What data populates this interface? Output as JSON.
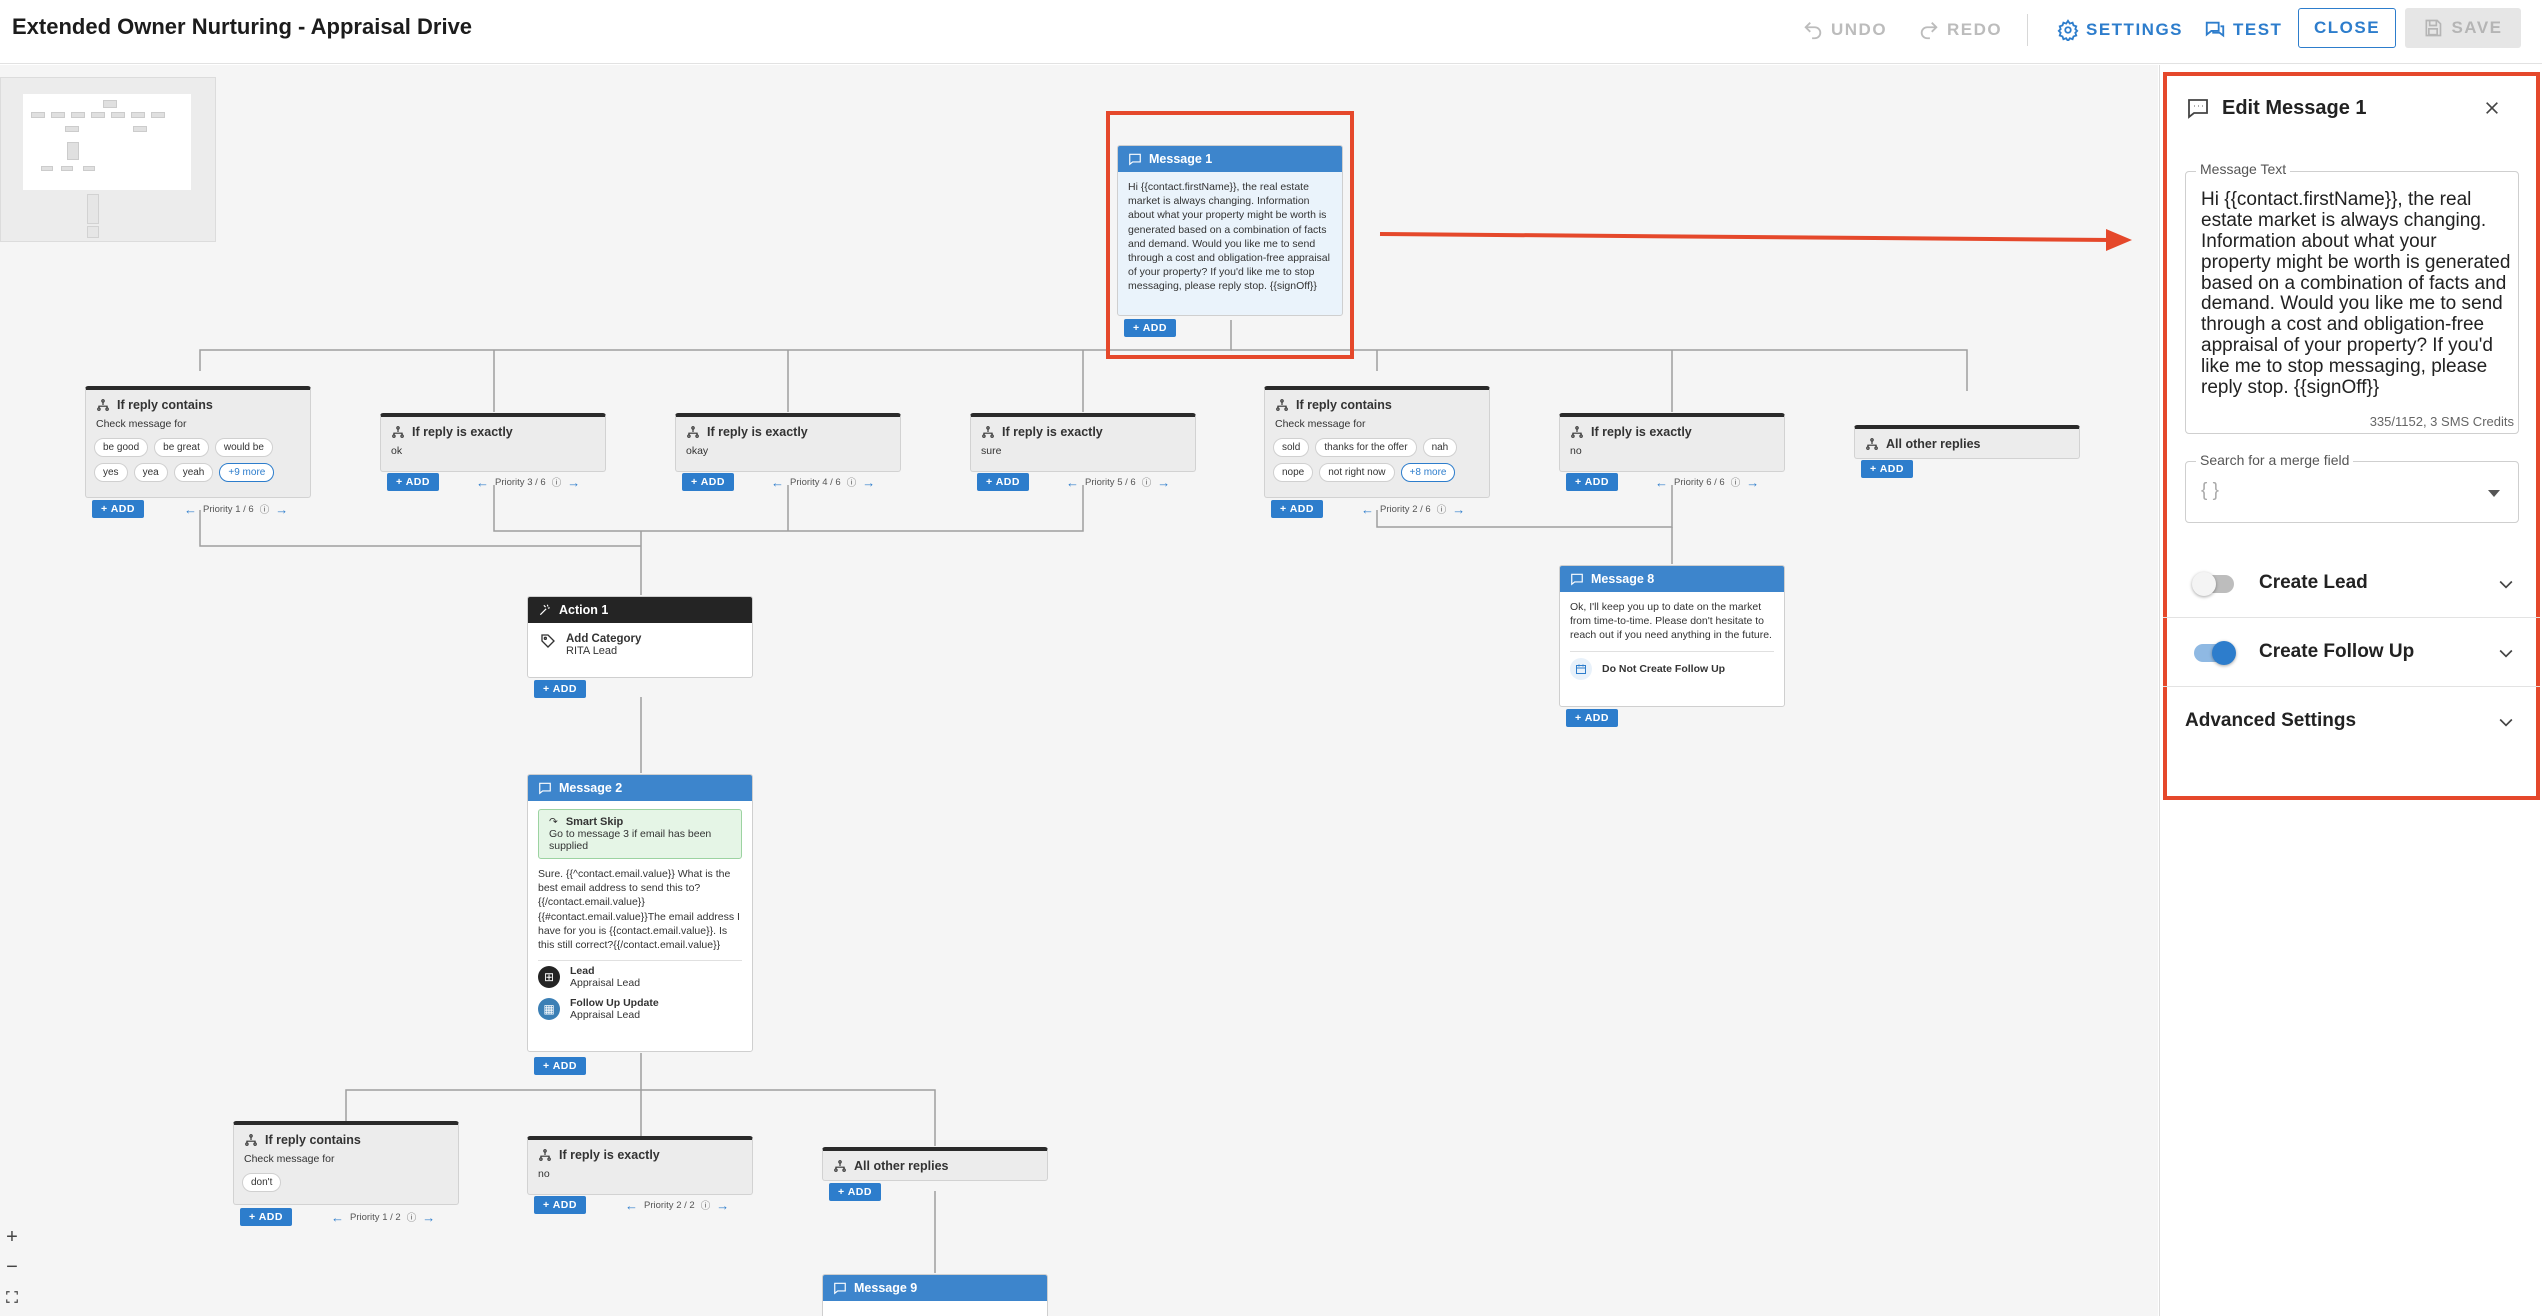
{
  "app": {
    "title": "Extended Owner Nurturing - Appraisal Drive"
  },
  "toolbar": {
    "undo": "UNDO",
    "redo": "REDO",
    "settings": "SETTINGS",
    "test": "TEST",
    "close": "CLOSE",
    "save": "SAVE"
  },
  "nodes": {
    "message1": {
      "title": "Message 1",
      "text": "Hi {{contact.firstName}}, the real estate market is always changing. Information about what your property might be worth is generated based on a combination of facts and demand. Would you like me to send through a cost and obligation-free appraisal of your property? If you'd like me to stop messaging, please reply stop. {{signOff}}"
    },
    "cond1": {
      "title": "If reply contains",
      "sub": "Check message for",
      "chips": [
        "be good",
        "be great",
        "would be",
        "yes",
        "yea",
        "yeah"
      ],
      "more": "+9 more",
      "priority": "Priority 1 / 6"
    },
    "cond2": {
      "title": "If reply is exactly",
      "value": "ok",
      "priority": "Priority 3 / 6"
    },
    "cond3": {
      "title": "If reply is exactly",
      "value": "okay",
      "priority": "Priority 4 / 6"
    },
    "cond4": {
      "title": "If reply is exactly",
      "value": "sure",
      "priority": "Priority 5 / 6"
    },
    "cond5": {
      "title": "If reply contains",
      "sub": "Check message for",
      "chips": [
        "sold",
        "thanks for the offer",
        "nah",
        "nope",
        "not right now"
      ],
      "more": "+8 more",
      "priority": "Priority 2 / 6"
    },
    "cond6": {
      "title": "If reply is exactly",
      "value": "no",
      "priority": "Priority 6 / 6"
    },
    "cond7": {
      "title": "All other replies"
    },
    "action1": {
      "title": "Action 1",
      "label": "Add Category",
      "value": "RITA Lead"
    },
    "message8": {
      "title": "Message 8",
      "text": "Ok, I'll keep you up to date on the market from time-to-time. Please don't hesitate to reach out if you need anything in the future.",
      "followup": "Do Not Create Follow Up"
    },
    "message2": {
      "title": "Message 2",
      "skip_title": "Smart Skip",
      "skip_text": "Go to message 3 if email has been supplied",
      "text": "Sure. {{^contact.email.value}} What is the best email address to send this to? {{/contact.email.value}} {{#contact.email.value}}The email address I have for you is {{contact.email.value}}. Is this still correct?{{/contact.email.value}}",
      "lead_label": "Lead",
      "lead_value": "Appraisal Lead",
      "fu_label": "Follow Up Update",
      "fu_value": "Appraisal Lead"
    },
    "cond8": {
      "title": "If reply contains",
      "sub": "Check message for",
      "chips": [
        "don't"
      ],
      "priority": "Priority 1 / 2"
    },
    "cond9": {
      "title": "If reply is exactly",
      "value": "no",
      "priority": "Priority 2 / 2"
    },
    "cond10": {
      "title": "All other replies"
    },
    "message9": {
      "title": "Message 9"
    },
    "add_label": "ADD"
  },
  "zoom": {
    "in": "+",
    "out": "−"
  },
  "panel": {
    "title": "Edit Message 1",
    "message_label": "Message Text",
    "message_text": "Hi {{contact.firstName}}, the real estate market is always changing. Information about what your property might be worth is generated based on a combination of facts and demand. Would you like me to send through a cost and obligation-free appraisal of your property? If you'd like me to stop messaging, please reply stop. {{signOff}}",
    "counter": "335/1152, 3 SMS Credits",
    "merge_label": "Search for a merge field",
    "merge_placeholder": "{ }",
    "create_lead": {
      "label": "Create Lead",
      "on": false
    },
    "create_followup": {
      "label": "Create Follow Up",
      "on": true
    },
    "advanced": "Advanced Settings"
  },
  "colors": {
    "accent": "#2d7dcc",
    "highlight": "#e5482b",
    "dark": "#242424"
  }
}
